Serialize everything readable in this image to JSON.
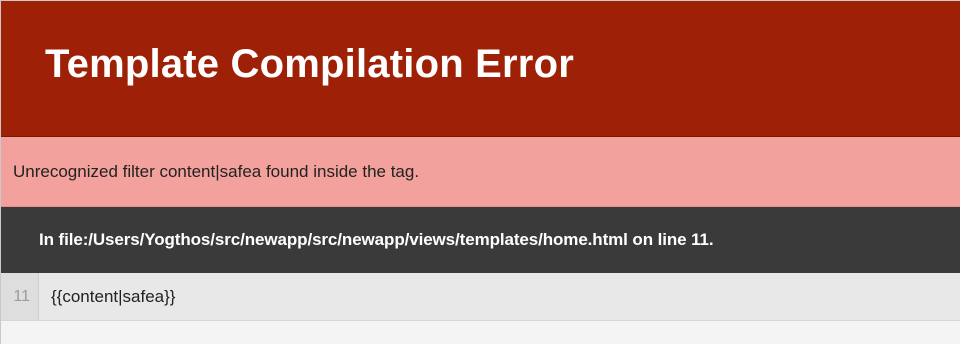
{
  "error": {
    "title": "Template Compilation Error",
    "message": "Unrecognized filter content|safea found inside the tag.",
    "file_info": "In file:/Users/Yogthos/src/newapp/src/newapp/views/templates/home.html on line 11."
  },
  "code": {
    "line_number": "11",
    "line_text": "{{content|safea}}"
  },
  "colors": {
    "header_bg": "#9e2006",
    "message_bg": "#f2a19c",
    "fileinfo_bg": "#3a3a3a",
    "code_bg": "#e8e8e8"
  }
}
